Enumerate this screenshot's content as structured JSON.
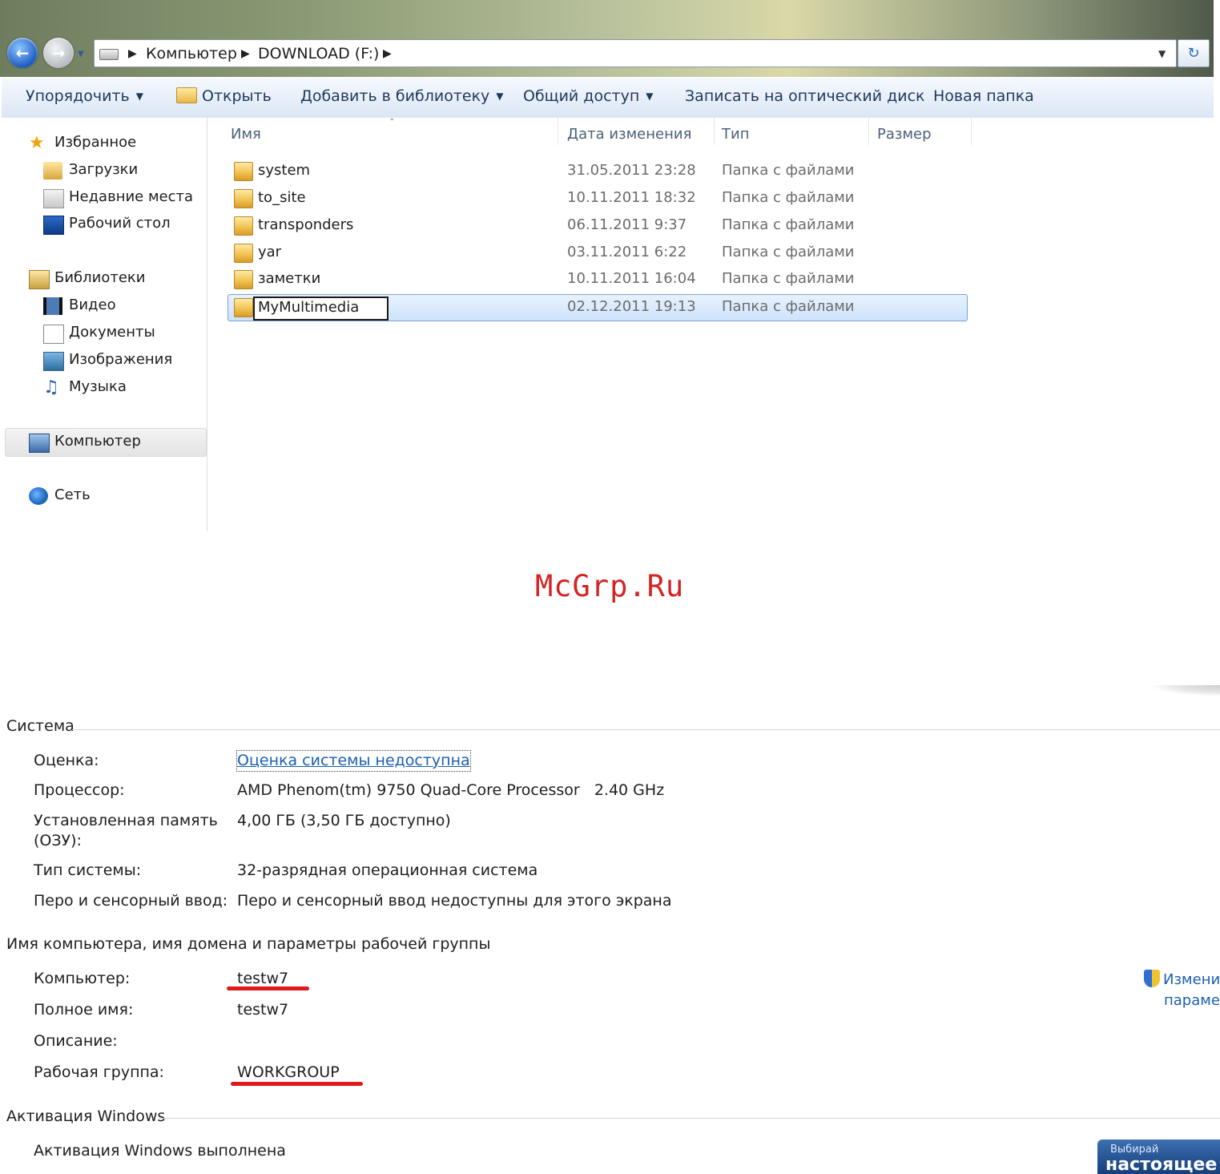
{
  "explorer": {
    "address": {
      "crumbs": [
        "Компьютер",
        "DOWNLOAD (F:)"
      ]
    },
    "toolbar": {
      "organize": "Упорядочить",
      "open": "Открыть",
      "add_to_library": "Добавить в библиотеку",
      "share": "Общий доступ",
      "burn": "Записать на оптический диск",
      "new_folder": "Новая папка"
    },
    "nav": {
      "favorites": "Избранное",
      "downloads": "Загрузки",
      "recent": "Недавние места",
      "desktop": "Рабочий стол",
      "libraries": "Библиотеки",
      "video": "Видео",
      "documents": "Документы",
      "images": "Изображения",
      "music": "Музыка",
      "computer": "Компьютер",
      "network": "Сеть"
    },
    "columns": {
      "name": "Имя",
      "modified": "Дата изменения",
      "type": "Тип",
      "size": "Размер"
    },
    "files": [
      {
        "name": "system",
        "modified": "31.05.2011 23:28",
        "type": "Папка с файлами"
      },
      {
        "name": "to_site",
        "modified": "10.11.2011 18:32",
        "type": "Папка с файлами"
      },
      {
        "name": "transponders",
        "modified": "06.11.2011 9:37",
        "type": "Папка с файлами"
      },
      {
        "name": "yar",
        "modified": "03.11.2011 6:22",
        "type": "Папка с файлами"
      },
      {
        "name": "заметки",
        "modified": "10.11.2011 16:04",
        "type": "Папка с файлами"
      },
      {
        "name": "MyMultimedia",
        "modified": "02.12.2011 19:13",
        "type": "Папка с файлами"
      }
    ]
  },
  "watermark": "McGrp.Ru",
  "system": {
    "section_title": "Система",
    "rating_label": "Оценка:",
    "rating_value": "Оценка системы недоступна",
    "cpu_label": "Процессор:",
    "cpu_value": "AMD Phenom(tm) 9750 Quad-Core Processor   2.40 GHz",
    "ram_label_1": "Установленная память",
    "ram_label_2": "(ОЗУ):",
    "ram_value": "4,00 ГБ (3,50 ГБ доступно)",
    "type_label": "Тип системы:",
    "type_value": "32-разрядная операционная система",
    "pen_label": "Перо и сенсорный ввод:",
    "pen_value": "Перо и сенсорный ввод недоступны для этого экрана"
  },
  "computer_name": {
    "section_title": "Имя компьютера, имя домена и параметры рабочей группы",
    "computer_label": "Компьютер:",
    "computer_value": "testw7",
    "fullname_label": "Полное имя:",
    "fullname_value": "testw7",
    "description_label": "Описание:",
    "workgroup_label": "Рабочая группа:",
    "workgroup_value": "WORKGROUP",
    "change_link_1": "Измени",
    "change_link_2": "параме"
  },
  "activation": {
    "section_title": "Активация Windows",
    "status": "Активация Windows выполнена",
    "banner_line1": "Выбирай",
    "banner_line2": "настоящее"
  },
  "colors": {
    "accent_link": "#1a5fb4",
    "highlight_underline": "#e01a1a",
    "watermark": "#d42323"
  }
}
